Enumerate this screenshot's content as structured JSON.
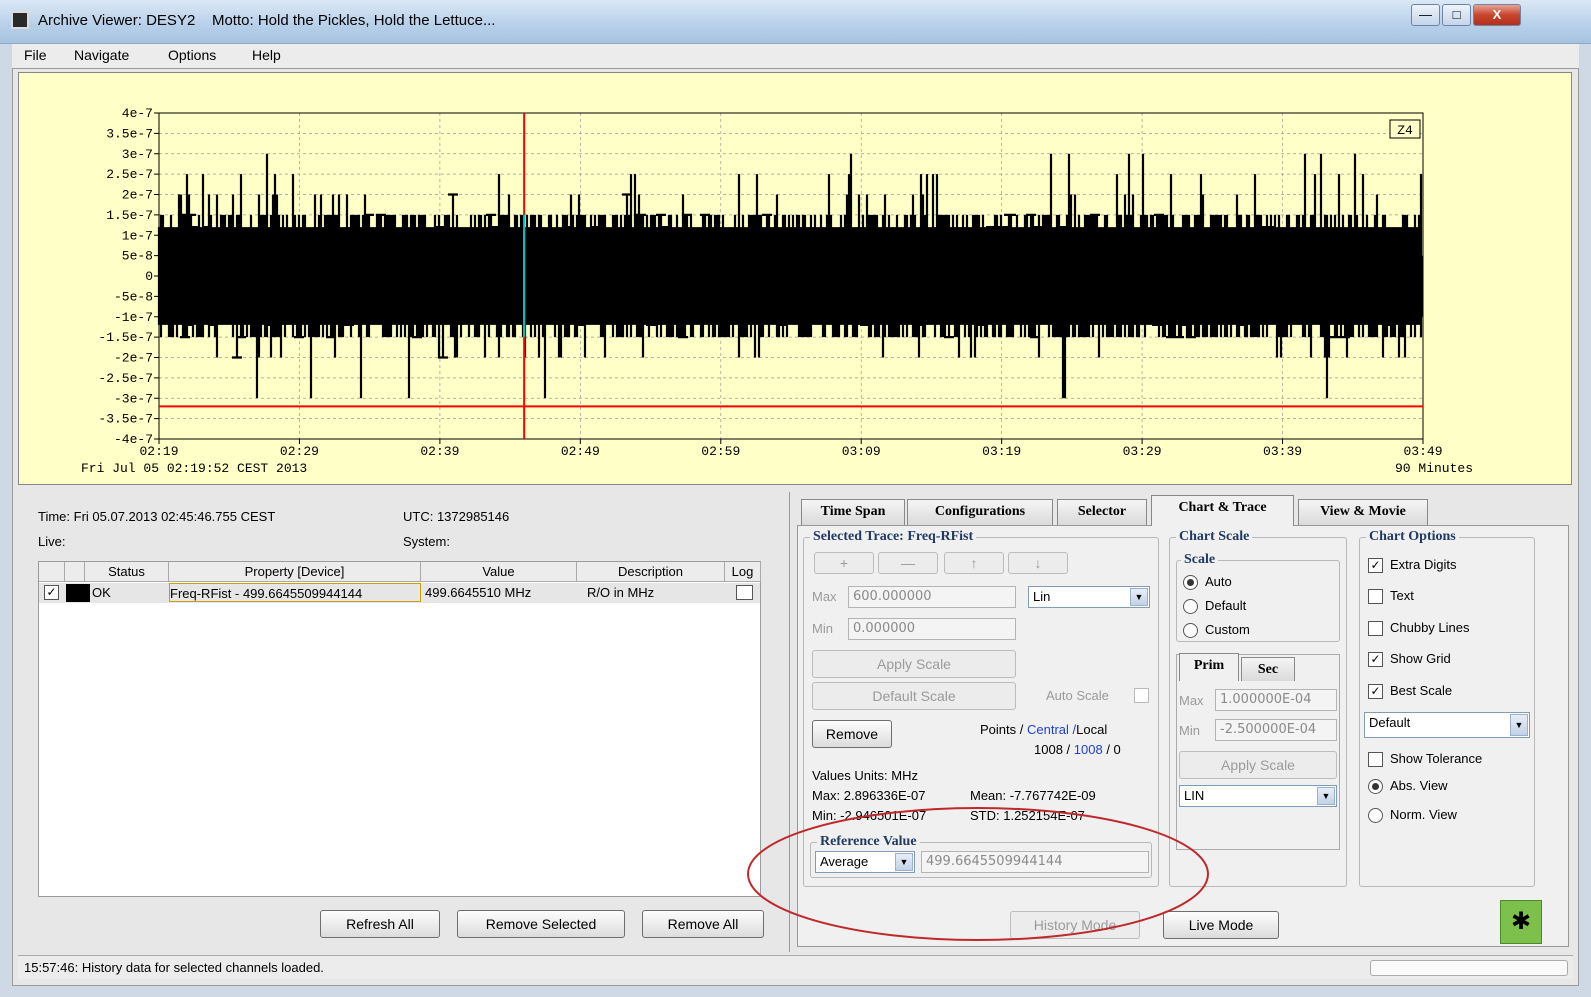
{
  "window": {
    "title": "Archive Viewer: DESY2",
    "motto": "Motto: Hold the Pickles, Hold the Lettuce...",
    "controls": [
      "—",
      "□",
      "X"
    ]
  },
  "menu": [
    "File",
    "Navigate",
    "Options",
    "Help"
  ],
  "chart": {
    "zoom_label": "Z4",
    "y_ticks": [
      "4e-7",
      "3.5e-7",
      "3e-7",
      "2.5e-7",
      "2e-7",
      "1.5e-7",
      "1e-7",
      "5e-8",
      "0",
      "-5e-8",
      "-1e-7",
      "-1.5e-7",
      "-2e-7",
      "-2.5e-7",
      "-3e-7",
      "-3.5e-7",
      "-4e-7"
    ],
    "x_ticks": [
      "02:19",
      "02:29",
      "02:39",
      "02:49",
      "02:59",
      "03:09",
      "03:19",
      "03:29",
      "03:39",
      "03:49"
    ],
    "start_label": "Fri Jul 05 02:19:52 CEST 2013",
    "span_label": "90 Minutes",
    "colors": {
      "background": "#ffffc8",
      "trace": "#000000",
      "cursor": "#ff0000",
      "highlight": "#00c8c8"
    }
  },
  "chart_data": {
    "type": "line",
    "ylim": [
      -4e-07,
      4e-07
    ],
    "x_range": [
      "02:19",
      "03:49"
    ],
    "cursor_time": "02:45:46",
    "reference_line": -3.2e-07,
    "series": [
      {
        "values_max": 2.896336e-07,
        "values_min": -2.946501e-07,
        "mean": -7.767742e-09
      }
    ]
  },
  "info": {
    "time": "Time: Fri 05.07.2013 02:45:46.755 CEST",
    "utc": "UTC: 1372985146",
    "live": "Live:",
    "system": "System:"
  },
  "table": {
    "headers": [
      "Status",
      "Property [Device]",
      "Value",
      "Description",
      "Log"
    ],
    "rows": [
      {
        "status": "OK",
        "property": "Freq-RFist - 499.6645509944144",
        "value": "499.6645510 MHz",
        "description": "R/O in MHz"
      }
    ]
  },
  "buttons": {
    "refresh_all": "Refresh All",
    "remove_selected": "Remove Selected",
    "remove_all": "Remove All"
  },
  "status": "15:57:46: History data for selected channels loaded.",
  "tabs": [
    "Time Span",
    "Configurations",
    "Selector",
    "Chart & Trace",
    "View & Movie"
  ],
  "selected_trace": {
    "title": "Selected Trace: Freq-RFist",
    "arrows": [
      "+",
      "—",
      "↑",
      "↓"
    ],
    "max_label": "Max",
    "max_value": "600.000000",
    "min_label": "Min",
    "min_value": "0.000000",
    "scale_mode": "Lin",
    "apply_scale": "Apply Scale",
    "default_scale": "Default Scale",
    "auto_scale": "Auto Scale",
    "remove": "Remove",
    "points_label": "Points /",
    "central_label": "Central",
    "sep": "/",
    "local_label": "Local",
    "points_count": "1008 /",
    "central_count": "1008",
    "local_count": "/ 0",
    "units": "Values Units: MHz",
    "max_stat": "Max: 2.896336E-07",
    "mean_stat": "Mean: -7.767742E-09",
    "min_stat": "Min:  -2.946501E-07",
    "std_stat": "STD:   1.252154E-07"
  },
  "reference": {
    "title": "Reference Value",
    "mode": "Average",
    "value": "499.6645509944144"
  },
  "chart_scale": {
    "title": "Chart Scale",
    "scale_title": "Scale",
    "options": [
      "Auto",
      "Default",
      "Custom"
    ],
    "selected": "Auto",
    "tabs": [
      "Prim",
      "Sec"
    ],
    "max_label": "Max",
    "max_value": "1.000000E-04",
    "min_label": "Min",
    "min_value": "-2.500000E-04",
    "apply_scale": "Apply Scale",
    "mode": "LIN"
  },
  "chart_options": {
    "title": "Chart Options",
    "checks": [
      {
        "label": "Extra Digits",
        "checked": true
      },
      {
        "label": "Text",
        "checked": false
      },
      {
        "label": "Chubby Lines",
        "checked": false
      },
      {
        "label": "Show Grid",
        "checked": true
      },
      {
        "label": "Best Scale",
        "checked": true
      }
    ],
    "style": "Default",
    "show_tolerance": "Show Tolerance",
    "abs_view": "Abs. View",
    "norm_view": "Norm. View"
  },
  "mode_buttons": {
    "history": "History Mode",
    "live": "Live Mode"
  }
}
